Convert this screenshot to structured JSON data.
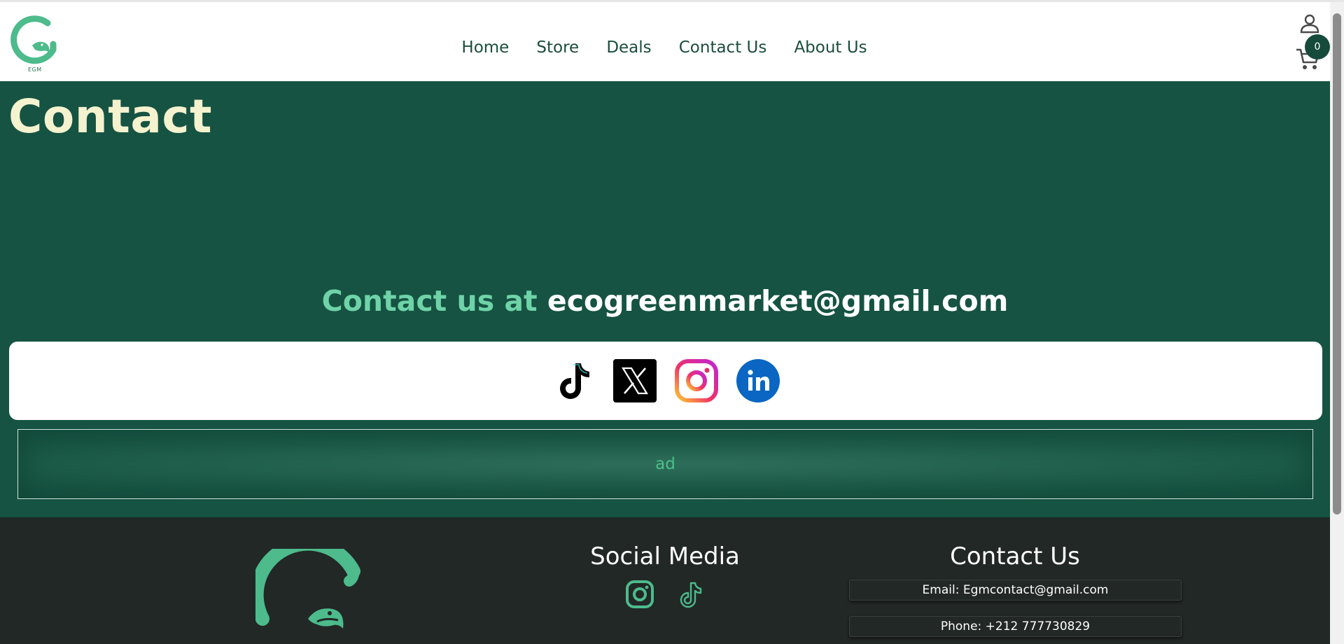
{
  "brand": {
    "logo_letter": "G",
    "logo_caption": "EGM",
    "color": "#4dbb8c"
  },
  "nav": {
    "items": [
      {
        "label": "Home"
      },
      {
        "label": "Store"
      },
      {
        "label": "Deals"
      },
      {
        "label": "Contact Us"
      },
      {
        "label": "About Us"
      }
    ]
  },
  "header_actions": {
    "user_icon": "user-icon",
    "cart_icon": "cart-icon",
    "cart_count": "0"
  },
  "main": {
    "title": "Contact",
    "contact_prefix": "Contact us at ",
    "contact_email": "ecogreenmarket@gmail.com",
    "social_icons": [
      "tiktok-icon",
      "x-icon",
      "instagram-icon",
      "linkedin-icon"
    ],
    "ad_label": "ad"
  },
  "footer": {
    "social_title": "Social Media",
    "social_icons": [
      "instagram-icon",
      "tiktok-icon"
    ],
    "contact_title": "Contact Us",
    "email_line": "Email: Egmcontact@gmail.com",
    "phone_line": "Phone: +212 777730829"
  },
  "colors": {
    "primary_green": "#165342",
    "accent_mint": "#6fd3a8",
    "title_cream": "#f4f2cf",
    "footer_bg": "#222826",
    "brand_green": "#4dbb8c"
  }
}
